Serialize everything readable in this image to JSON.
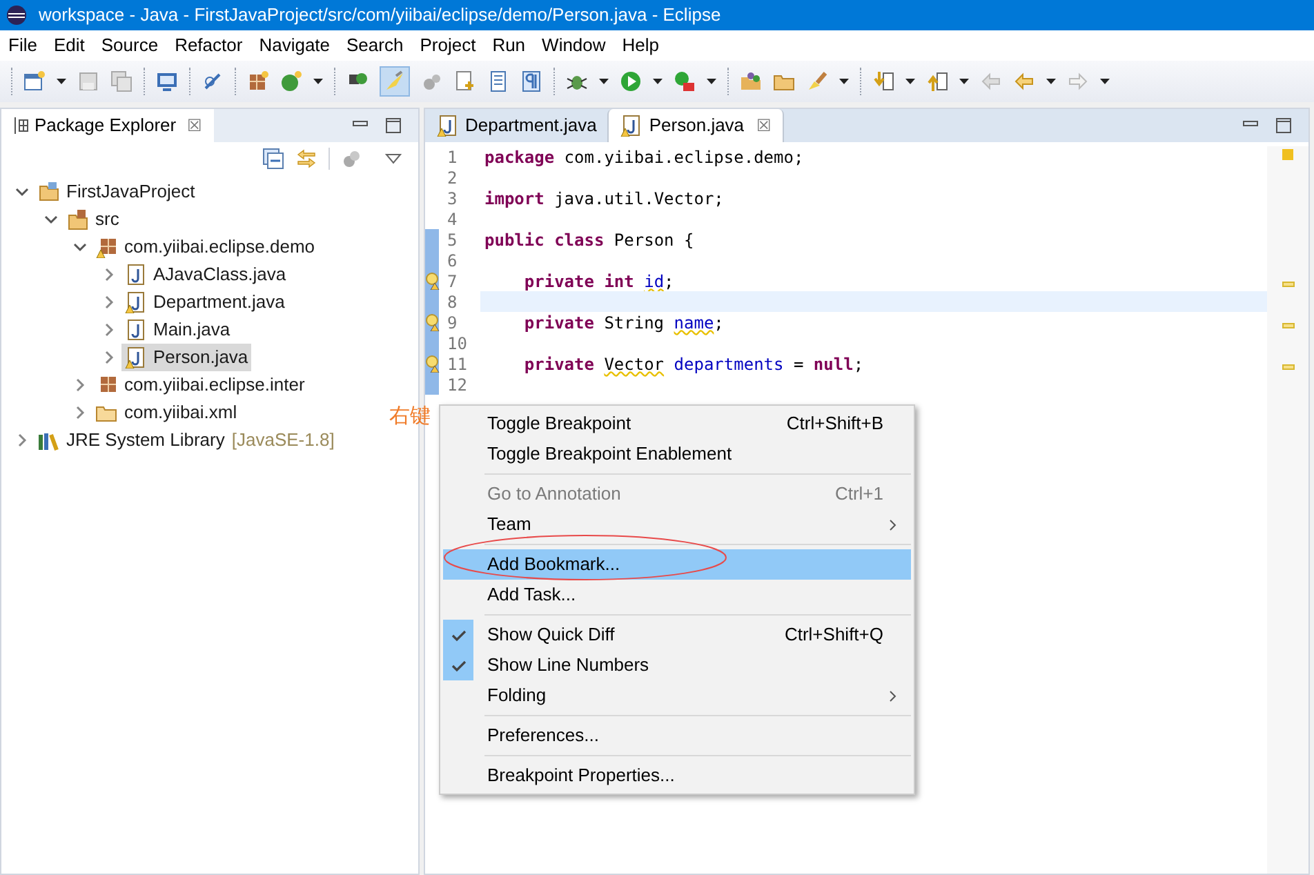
{
  "window": {
    "title": "workspace - Java - FirstJavaProject/src/com/yiibai/eclipse/demo/Person.java - Eclipse"
  },
  "menu_bar": [
    "File",
    "Edit",
    "Source",
    "Refactor",
    "Navigate",
    "Search",
    "Project",
    "Run",
    "Window",
    "Help"
  ],
  "package_explorer": {
    "title": "Package Explorer",
    "close": "☒",
    "tree": [
      {
        "label": "FirstJavaProject",
        "kind": "project",
        "expanded": true,
        "selected": false,
        "children": [
          {
            "label": "src",
            "kind": "source",
            "expanded": true,
            "selected": false,
            "children": [
              {
                "label": "com.yiibai.eclipse.demo",
                "kind": "package",
                "expanded": true,
                "selected": false,
                "warning": true,
                "children": [
                  {
                    "label": "AJavaClass.java",
                    "kind": "file",
                    "expanded": false,
                    "selected": false,
                    "warning": false
                  },
                  {
                    "label": "Department.java",
                    "kind": "file",
                    "expanded": false,
                    "selected": false,
                    "warning": true
                  },
                  {
                    "label": "Main.java",
                    "kind": "file",
                    "expanded": false,
                    "selected": false,
                    "warning": false
                  },
                  {
                    "label": "Person.java",
                    "kind": "file",
                    "expanded": false,
                    "selected": true,
                    "warning": true
                  }
                ]
              },
              {
                "label": "com.yiibai.eclipse.inter",
                "kind": "package",
                "expanded": false,
                "selected": false,
                "warning": false
              },
              {
                "label": "com.yiibai.xml",
                "kind": "folder",
                "expanded": false,
                "selected": false,
                "warning": false
              }
            ]
          }
        ]
      },
      {
        "label": "JRE System Library",
        "suffix": "[JavaSE-1.8]",
        "kind": "library",
        "expanded": false,
        "selected": false
      }
    ]
  },
  "editor": {
    "tabs": [
      {
        "label": "Department.java",
        "selected": false
      },
      {
        "label": "Person.java",
        "selected": true,
        "close": "☒"
      }
    ],
    "lines": [
      {
        "number": "1",
        "tokens": [
          {
            "text": "package",
            "kind": "keyword"
          },
          {
            "text": "com.yiibai.eclipse.demo;",
            "kind": "plain",
            "spaced": true
          }
        ]
      },
      {
        "number": "2"
      },
      {
        "number": "3",
        "tokens": [
          {
            "text": "import",
            "kind": "keyword"
          },
          {
            "text": "java.util.Vector;",
            "kind": "plain",
            "spaced": true
          }
        ]
      },
      {
        "number": "4"
      },
      {
        "number": "5",
        "tokens": [
          {
            "text": "public class",
            "kind": "keyword"
          },
          {
            "text": "Person {",
            "kind": "plain",
            "spaced": true
          }
        ]
      },
      {
        "number": "6"
      },
      {
        "number": "7",
        "warning": true,
        "indented": true,
        "tokens": [
          {
            "text": "private int",
            "kind": "keyword"
          },
          {
            "text": "id",
            "kind": "field_warn",
            "spaced": true
          },
          {
            "text": ";",
            "kind": "plain"
          }
        ]
      },
      {
        "number": "8",
        "current": true
      },
      {
        "number": "9",
        "warning": true,
        "indented": true,
        "tokens": [
          {
            "text": "private",
            "kind": "keyword"
          },
          {
            "text": "String",
            "kind": "plain",
            "spaced": true
          },
          {
            "text": "name",
            "kind": "field_warn",
            "spaced": true
          },
          {
            "text": ";",
            "kind": "plain"
          }
        ]
      },
      {
        "number": "10"
      },
      {
        "number": "11",
        "warning": true,
        "indented": true,
        "tokens": [
          {
            "text": "private",
            "kind": "keyword"
          },
          {
            "text": "Vector",
            "kind": "type_warn",
            "spaced": true
          },
          {
            "text": "departments",
            "kind": "field",
            "spaced": true
          },
          {
            "text": "=",
            "kind": "plain",
            "spaced": true
          },
          {
            "text": "null",
            "kind": "keyword",
            "spaced": true
          },
          {
            "text": ";",
            "kind": "plain"
          }
        ]
      },
      {
        "number": "12"
      }
    ]
  },
  "annotation": {
    "text": "右键"
  },
  "context_menu": [
    {
      "kind": "item",
      "label": "Toggle Breakpoint",
      "shortcut": "Ctrl+Shift+B",
      "disabled": false,
      "checked": false,
      "selected": false
    },
    {
      "kind": "item",
      "label": "Toggle Breakpoint Enablement",
      "disabled": false,
      "checked": false,
      "selected": false
    },
    {
      "kind": "separator"
    },
    {
      "kind": "item",
      "label": "Go to Annotation",
      "shortcut": "Ctrl+1",
      "disabled": true,
      "checked": false,
      "selected": false
    },
    {
      "kind": "submenu",
      "label": "Team",
      "disabled": false,
      "checked": false,
      "selected": false
    },
    {
      "kind": "separator"
    },
    {
      "kind": "item",
      "label": "Add Bookmark...",
      "disabled": false,
      "checked": false,
      "selected": true
    },
    {
      "kind": "item",
      "label": "Add Task...",
      "disabled": false,
      "checked": false,
      "selected": false
    },
    {
      "kind": "separator"
    },
    {
      "kind": "item",
      "label": "Show Quick Diff",
      "shortcut": "Ctrl+Shift+Q",
      "disabled": false,
      "checked": true,
      "selected": false
    },
    {
      "kind": "item",
      "label": "Show Line Numbers",
      "disabled": false,
      "checked": true,
      "selected": false
    },
    {
      "kind": "submenu",
      "label": "Folding",
      "disabled": false,
      "checked": false,
      "selected": false
    },
    {
      "kind": "separator"
    },
    {
      "kind": "item",
      "label": "Preferences...",
      "disabled": false,
      "checked": false,
      "selected": false
    },
    {
      "kind": "separator"
    },
    {
      "kind": "item",
      "label": "Breakpoint Properties...",
      "disabled": false,
      "checked": false,
      "selected": false
    }
  ]
}
